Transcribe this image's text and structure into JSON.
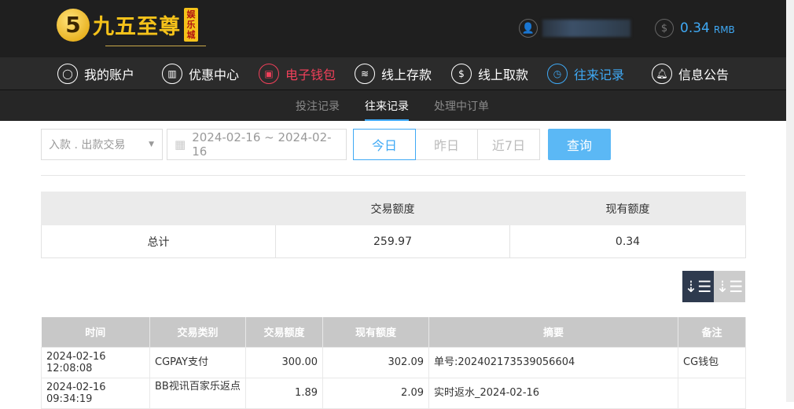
{
  "header": {
    "logo_text": "九五至尊",
    "logo_tag": "娱乐城",
    "balance": "0.34",
    "currency": "RMB"
  },
  "nav": [
    {
      "label": "我的账户",
      "icon": "user-icon"
    },
    {
      "label": "优惠中心",
      "icon": "gift-icon"
    },
    {
      "label": "电子钱包",
      "icon": "wallet-icon"
    },
    {
      "label": "线上存款",
      "icon": "deposit-icon"
    },
    {
      "label": "线上取款",
      "icon": "withdraw-icon"
    },
    {
      "label": "往来记录",
      "icon": "records-icon"
    },
    {
      "label": "信息公告",
      "icon": "bell-icon"
    }
  ],
  "subnav": [
    "投注记录",
    "往来记录",
    "处理中订单"
  ],
  "filter": {
    "type": "入款 . 出款交易",
    "date_range": "2024-02-16 ~ 2024-02-16",
    "today": "今日",
    "yesterday": "昨日",
    "last7": "近7日",
    "query": "查询"
  },
  "summary": {
    "headers": [
      "",
      "交易额度",
      "现有额度"
    ],
    "row": [
      "总计",
      "259.97",
      "0.34"
    ]
  },
  "table": {
    "headers": [
      "时间",
      "交易类别",
      "交易额度",
      "现有额度",
      "摘要",
      "备注"
    ],
    "rows": [
      [
        "2024-02-16 12:08:08",
        "CGPAY支付",
        "300.00",
        "302.09",
        "单号:202402173539056604",
        "CG钱包"
      ],
      [
        "2024-02-16 09:34:19",
        "BB视讯百家乐返点",
        "1.89",
        "2.09",
        "实时返水_2024-02-16",
        ""
      ]
    ]
  },
  "colors": {
    "accent": "#3fa9f5",
    "wallet": "#f0405a"
  }
}
